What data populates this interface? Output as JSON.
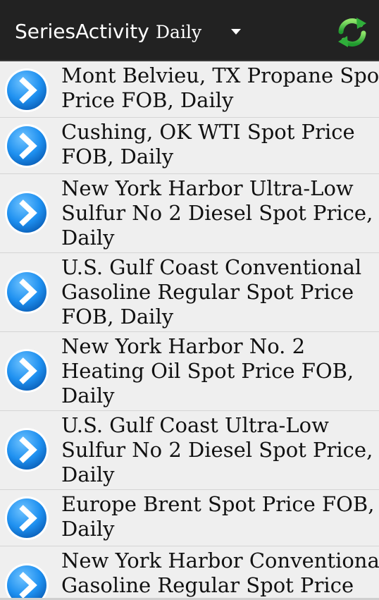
{
  "actionbar": {
    "title": "SeriesActivity",
    "spinner_value": "Daily",
    "refresh_icon": "refresh-icon"
  },
  "series": [
    {
      "label": "Mont Belvieu, TX Propane Spot\nPrice FOB, Daily"
    },
    {
      "label": "Cushing, OK WTI Spot Price\nFOB, Daily"
    },
    {
      "label": "New York Harbor Ultra-Low\nSulfur No 2 Diesel Spot Price,\nDaily"
    },
    {
      "label": "U.S. Gulf Coast Conventional\nGasoline Regular Spot Price\nFOB, Daily"
    },
    {
      "label": "New York Harbor No. 2\nHeating Oil Spot Price FOB,\nDaily"
    },
    {
      "label": "U.S. Gulf Coast Ultra-Low\nSulfur No 2 Diesel Spot Price,\nDaily"
    },
    {
      "label": "Europe Brent Spot Price FOB,\nDaily"
    },
    {
      "label": "New York Harbor Conventional\nGasoline Regular Spot Price"
    }
  ],
  "colors": {
    "actionbar_bg": "#222222",
    "list_bg": "#efefef",
    "chevron_blue": "#1e90f0",
    "refresh_green": "#3cb44b"
  }
}
